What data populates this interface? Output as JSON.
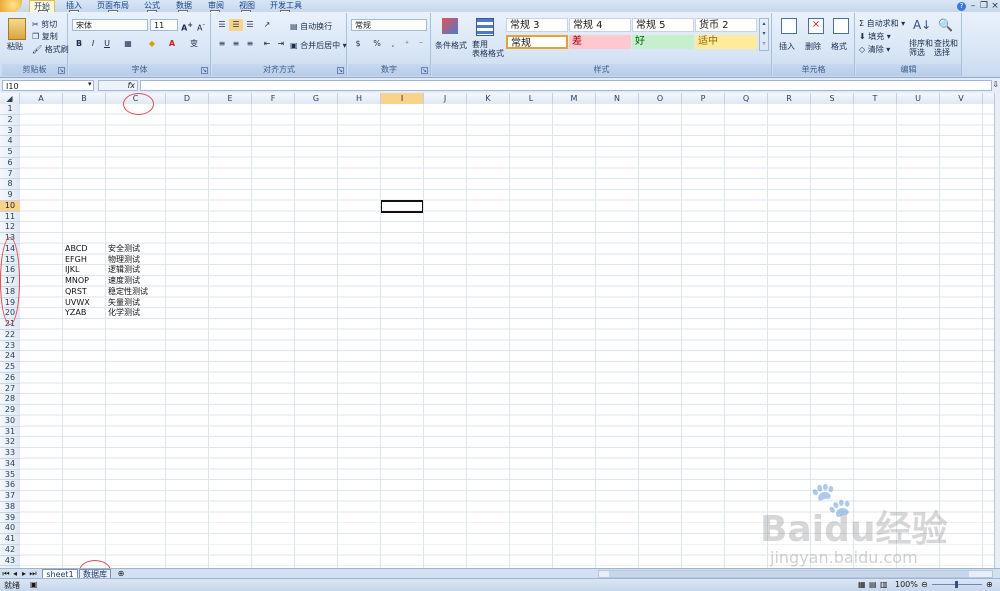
{
  "tabs": [
    {
      "label": "开始",
      "key": "H"
    },
    {
      "label": "插入",
      "key": "N"
    },
    {
      "label": "页面布局",
      "key": "P"
    },
    {
      "label": "公式",
      "key": "M"
    },
    {
      "label": "数据",
      "key": "A"
    },
    {
      "label": "审阅",
      "key": "R"
    },
    {
      "label": "视图",
      "key": "W"
    },
    {
      "label": "开发工具",
      "key": "L"
    }
  ],
  "ribbon": {
    "clipboard": {
      "label": "剪贴板",
      "paste": "粘贴",
      "cut": "剪切",
      "copy": "复制",
      "format_painter": "格式刷"
    },
    "font": {
      "label": "字体",
      "name": "宋体",
      "size": "11",
      "bold": "B",
      "italic": "I",
      "underline": "U",
      "wen": "变"
    },
    "alignment": {
      "label": "对齐方式",
      "wrap": "自动换行",
      "merge": "合并后居中"
    },
    "number": {
      "label": "数字",
      "format": "常规",
      "percent": "%"
    },
    "styles": {
      "label": "样式",
      "conditional": "条件格式",
      "table_format": "套用\n表格格式",
      "cells": [
        {
          "text": "常规 3"
        },
        {
          "text": "常规 4"
        },
        {
          "text": "常规 5"
        },
        {
          "text": "货币 2"
        },
        {
          "text": "常规"
        },
        {
          "text": "差"
        },
        {
          "text": "好"
        },
        {
          "text": "适中"
        }
      ]
    },
    "cells": {
      "label": "单元格",
      "insert": "插入",
      "delete": "删除",
      "format": "格式"
    },
    "editing": {
      "label": "编辑",
      "autosum": "自动求和",
      "fill": "填充",
      "clear": "清除",
      "sort": "排序和\n筛选",
      "find": "查找和\n选择"
    }
  },
  "formula_bar": {
    "name_box": "I10",
    "fx": "fx",
    "formula": ""
  },
  "columns": [
    "A",
    "B",
    "C",
    "D",
    "E",
    "F",
    "G",
    "H",
    "I",
    "J",
    "K",
    "L",
    "M",
    "N",
    "O",
    "P",
    "Q",
    "R",
    "S",
    "T",
    "U",
    "V"
  ],
  "selected_column": "I",
  "selected_row": "10",
  "rows_count": 43,
  "cells": [
    {
      "row": 14,
      "b": "ABCD",
      "c": "安全测试"
    },
    {
      "row": 15,
      "b": "EFGH",
      "c": "物理测试"
    },
    {
      "row": 16,
      "b": "IJKL",
      "c": "逻辑测试"
    },
    {
      "row": 17,
      "b": "MNOP",
      "c": "速度测试"
    },
    {
      "row": 18,
      "b": "QRST",
      "c": "稳定性测试"
    },
    {
      "row": 19,
      "b": "UVWX",
      "c": "矢量测试"
    },
    {
      "row": 20,
      "b": "YZAB",
      "c": "化学测试"
    }
  ],
  "sheets": [
    {
      "label": "sheet1"
    },
    {
      "label": "数据库"
    }
  ],
  "status": {
    "ready": "就绪",
    "zoom": "100%"
  },
  "watermark": {
    "brand": "Baidu经验",
    "url": "jingyan.baidu.com"
  },
  "colors": {
    "accent": "#15428b",
    "selection": "#f9d28b",
    "annotation": "#e24b4b"
  }
}
